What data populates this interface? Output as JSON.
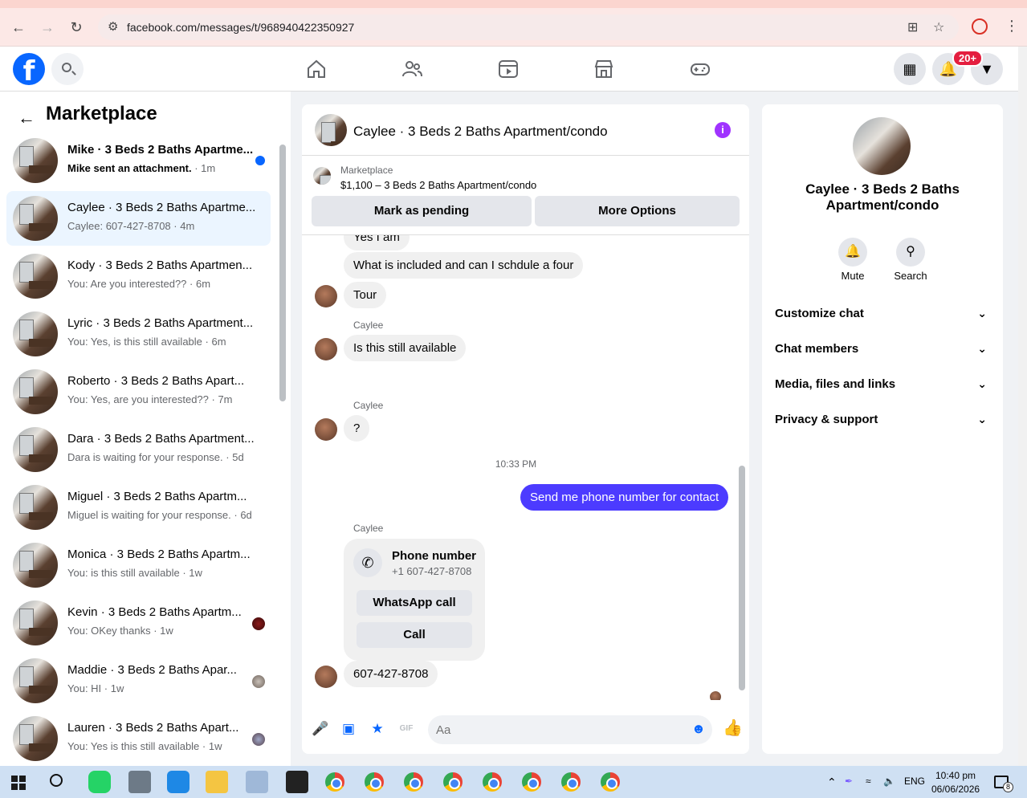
{
  "browser": {
    "url": "facebook.com/messages/t/968940422350927"
  },
  "header": {
    "notification_badge": "20+"
  },
  "left": {
    "title": "Marketplace",
    "conversations": [
      {
        "name": "Mike · 3 Beds 2 Baths Apartme...",
        "sub": "Mike sent an attachment.",
        "time": " · 1m",
        "unread": true
      },
      {
        "name": "Caylee · 3 Beds 2 Baths Apartme...",
        "sub": "Caylee: 607-427-8708",
        "time": " · 4m",
        "selected": true
      },
      {
        "name": "Kody · 3 Beds 2 Baths Apartmen...",
        "sub": "You: Are you interested??",
        "time": " · 6m"
      },
      {
        "name": "Lyric · 3 Beds 2 Baths Apartment...",
        "sub": "You: Yes, is this still available",
        "time": " · 6m"
      },
      {
        "name": "Roberto · 3 Beds 2 Baths Apart...",
        "sub": "You: Yes, are you interested??",
        "time": " · 7m"
      },
      {
        "name": "Dara · 3 Beds 2 Baths Apartment...",
        "sub": "Dara is waiting for your response.",
        "time": " · 5d"
      },
      {
        "name": "Miguel · 3 Beds 2 Baths Apartm...",
        "sub": "Miguel is waiting for your response.",
        "time": " · 6d"
      },
      {
        "name": "Monica · 3 Beds 2 Baths Apartm...",
        "sub": "You: is this still available",
        "time": " · 1w"
      },
      {
        "name": "Kevin · 3 Beds 2 Baths Apartm...",
        "sub": "You: OKey thanks",
        "time": " · 1w"
      },
      {
        "name": "Maddie · 3 Beds 2 Baths Apar...",
        "sub": "You: HI",
        "time": " · 1w"
      },
      {
        "name": "Lauren · 3 Beds 2 Baths Apart...",
        "sub": "You: Yes is this still available",
        "time": " · 1w"
      }
    ]
  },
  "chat": {
    "title": "Caylee · 3 Beds 2 Baths Apartment/condo",
    "marketplace_label": "Marketplace",
    "listing": "$1,100 – 3 Beds 2 Baths Apartment/condo",
    "mark_pending": "Mark as pending",
    "more_options": "More Options",
    "messages": {
      "m0": "Yes I am",
      "m1": "What is included and can I schdule a four",
      "m2": "Tour",
      "sender": "Caylee",
      "m3": "Is this still available",
      "m4": "?",
      "time": "10:33 PM",
      "m5": "Send me phone number for contact",
      "card_title": "Phone number",
      "card_number": "+1 607-427-8708",
      "whatsapp": "WhatsApp call",
      "call": "Call",
      "m6": "607-427-8708"
    },
    "input_placeholder": "Aa"
  },
  "right": {
    "name": "Caylee · 3 Beds 2 Baths Apartment/condo",
    "mute": "Mute",
    "search": "Search",
    "sections": [
      "Customize chat",
      "Chat members",
      "Media, files and links",
      "Privacy & support"
    ]
  },
  "taskbar": {
    "lang": "ENG",
    "time": "10:40 pm",
    "date": "06/06/2026",
    "notif_count": "8"
  }
}
